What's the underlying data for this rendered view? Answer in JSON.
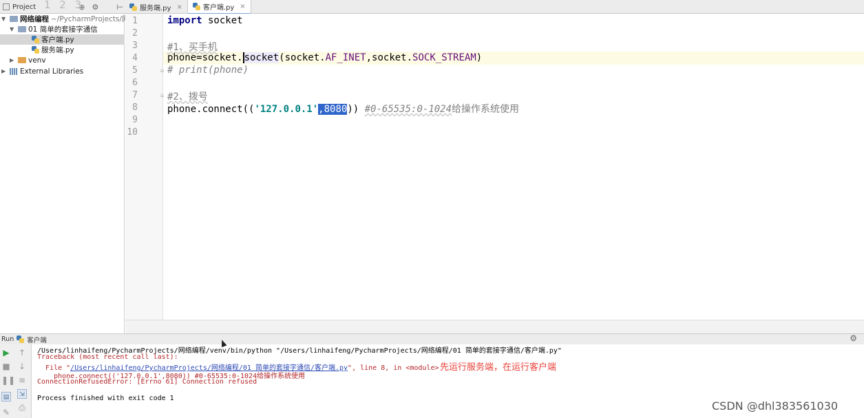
{
  "project_panel": {
    "title": "Project",
    "overlay_glyphs": "1 2 3"
  },
  "tabs": [
    {
      "label": "服务端.py",
      "active": false
    },
    {
      "label": "客户端.py",
      "active": true
    }
  ],
  "tree": {
    "root_name": "网络编程",
    "root_path": "~/PycharmProjects/网",
    "folder": "01 简单的套接字通信",
    "file_selected": "客户端.py",
    "file_other": "服务端.py",
    "venv": "venv",
    "libraries": "External Libraries"
  },
  "editor": {
    "line_numbers": [
      "1",
      "2",
      "3",
      "4",
      "5",
      "6",
      "7",
      "8",
      "9",
      "10"
    ],
    "code": {
      "l1_kw": "import",
      "l1_rest": " socket",
      "l3": "#1、买手机",
      "l4_a": "phone=socket.",
      "l4_b": "socket",
      "l4_c": "(socket.",
      "l4_d": "AF_INET",
      "l4_e": ",socket.",
      "l4_f": "SOCK_STREAM",
      "l4_g": ")",
      "l5": "# print(phone)",
      "l7": "#2、拨号",
      "l8_a": "phone.connect((",
      "l8_b": "'127.0.0.1'",
      "l8_c": ",8080",
      "l8_d": ")) ",
      "l8_e": "#0-65535:0-1024",
      "l8_f": "给操作系统使用"
    }
  },
  "run_panel": {
    "label": "Run",
    "config": "客户端",
    "console": {
      "line1": "/Users/linhaifeng/PycharmProjects/网络编程/venv/bin/python \"/Users/linhaifeng/PycharmProjects/网络编程/01 简单的套接字通信/客户端.py\"",
      "line2": "Traceback (most recent call last):",
      "line3_pre": "  File \"",
      "line3_link": "/Users/linhaifeng/PycharmProjects/网络编程/01 简单的套接字通信/客户端.py",
      "line3_post": "\", line 8, in <module>",
      "line4": "    phone.connect(('127.0.0.1',8080)) #0-65535:0-1024给操作系统使用",
      "line5": "ConnectionRefusedError: [Errno 61] Connection refused",
      "line6": "Process finished with exit code 1"
    }
  },
  "annotation": "先运行服务端，在运行客户端",
  "watermark": "CSDN @dhl383561030",
  "colors": {
    "keyword": "#000080",
    "string": "#008080",
    "comment": "#808080",
    "error_text": "#b3262a",
    "annotation": "#e8413a",
    "selection": "#2f65ca"
  }
}
